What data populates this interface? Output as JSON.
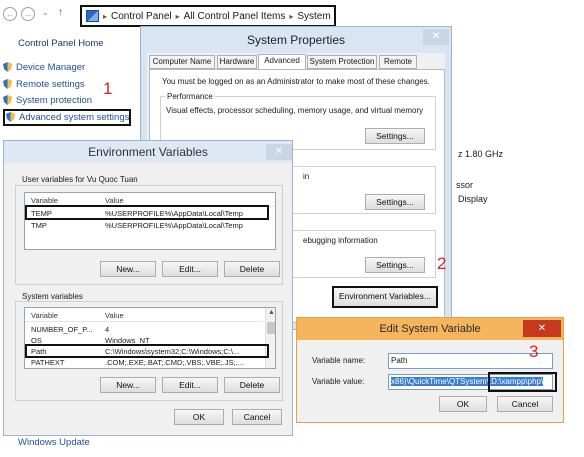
{
  "address": {
    "parts": [
      "Control Panel",
      "All Control Panel Items",
      "System"
    ]
  },
  "left_nav": {
    "home": "Control Panel Home",
    "items": [
      "Device Manager",
      "Remote settings",
      "System protection",
      "Advanced system settings"
    ],
    "bottom": "Windows Update"
  },
  "background_fragments": {
    "cpu": "z  1.80 GHz",
    "ssor": "ssor",
    "display": "Display"
  },
  "annotations": {
    "one": "1",
    "two": "2",
    "three": "3"
  },
  "system_properties": {
    "title": "System Properties",
    "close": "✕",
    "tabs": [
      "Computer Name",
      "Hardware",
      "Advanced",
      "System Protection",
      "Remote"
    ],
    "admin_note": "You must be logged on as an Administrator to make most of these changes.",
    "performance": {
      "title": "Performance",
      "text": "Visual effects, processor scheduling, memory usage, and virtual memory",
      "button": "Settings..."
    },
    "group2_fragment": "in",
    "group2_button": "Settings...",
    "group3_fragment": "ebugging information",
    "group3_button": "Settings...",
    "env_button": "Environment Variables..."
  },
  "environment_variables": {
    "title": "Environment Variables",
    "close": "✕",
    "user_label": "User variables for Vu Quoc Tuan",
    "columns": [
      "Variable",
      "Value"
    ],
    "user_rows": [
      {
        "variable": "TEMP",
        "value": "%USERPROFILE%\\AppData\\Local\\Temp"
      },
      {
        "variable": "TMP",
        "value": "%USERPROFILE%\\AppData\\Local\\Temp"
      }
    ],
    "user_buttons": [
      "New...",
      "Edit...",
      "Delete"
    ],
    "system_label": "System variables",
    "system_rows": [
      {
        "variable": "NUMBER_OF_P...",
        "value": "4"
      },
      {
        "variable": "OS",
        "value": "Windows_NT"
      },
      {
        "variable": "Path",
        "value": "C:\\Windows\\system32;C:\\Windows;C:\\..."
      },
      {
        "variable": "PATHEXT",
        "value": ".COM;.EXE;.BAT;.CMD;.VBS;.VBE;.JS;...."
      }
    ],
    "system_buttons": [
      "New...",
      "Edit...",
      "Delete"
    ],
    "ok": "OK",
    "cancel": "Cancel"
  },
  "edit_system_variable": {
    "title": "Edit System Variable",
    "close": "✕",
    "name_label": "Variable name:",
    "name_value": "Path",
    "value_label": "Variable value:",
    "value_selected": "x86)\\QuickTime\\QTSystem\\",
    "value_tail": ";D:\\xampp\\php\\",
    "ok": "OK",
    "cancel": "Cancel"
  }
}
